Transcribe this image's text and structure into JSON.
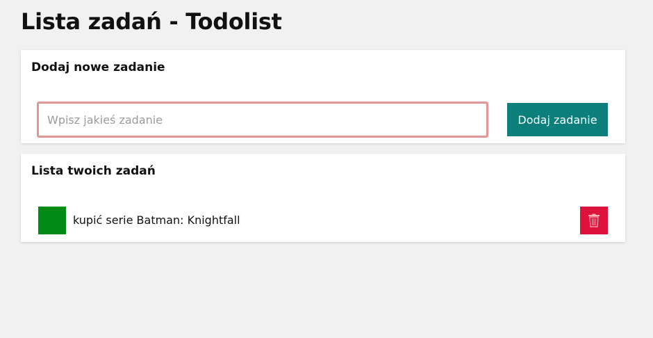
{
  "page": {
    "title": "Lista zadań - Todolist"
  },
  "add_section": {
    "heading": "Dodaj nowe zadanie",
    "input_placeholder": "Wpisz jakieś zadanie",
    "input_value": "",
    "button_label": "Dodaj zadanie"
  },
  "list_section": {
    "heading": "Lista twoich zadań",
    "tasks": [
      {
        "text": "kupić serie Batman: Knightfall",
        "complete_icon": "checkbox-icon",
        "delete_icon": "trash-icon"
      }
    ]
  },
  "colors": {
    "background": "#f1f1f1",
    "input_border": "#e29696",
    "add_button": "#0d7f7b",
    "complete_box": "#018a15",
    "delete_button": "#dc143c"
  }
}
